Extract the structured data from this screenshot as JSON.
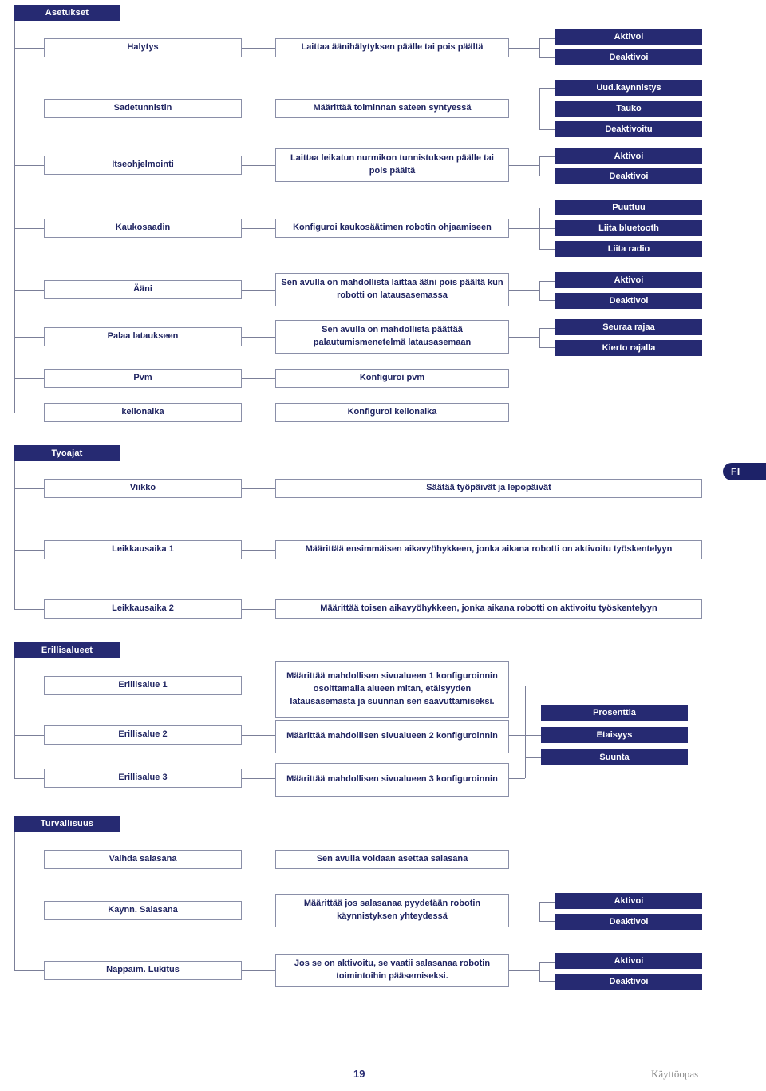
{
  "page": {
    "number": "19",
    "footer_label": "Käyttöopas",
    "language_tab": "FI",
    "accent_navy": "#262a72",
    "box_border": "#8a8fa8",
    "connector": "#7b7f98"
  },
  "sections": [
    {
      "id": "asetukset",
      "title": "Asetukset",
      "rows": [
        {
          "name": "Halytys",
          "description": "Laittaa äänihälytyksen päälle tai pois päältä",
          "options": [
            "Aktivoi",
            "Deaktivoi"
          ]
        },
        {
          "name": "Sadetunnistin",
          "description": "Määrittää toiminnan sateen syntyessä",
          "options": [
            "Uud.kaynnistys",
            "Tauko",
            "Deaktivoitu"
          ]
        },
        {
          "name": "Itseohjelmointi",
          "description": "Laittaa leikatun nurmikon tunnistuksen päälle tai pois päältä",
          "options": [
            "Aktivoi",
            "Deaktivoi"
          ]
        },
        {
          "name": "Kaukosaadin",
          "description": "Konfiguroi kaukosäätimen robotin ohjaamiseen",
          "options": [
            "Puuttuu",
            "Liita bluetooth",
            "Liita radio"
          ]
        },
        {
          "name": "Ääni",
          "description": "Sen avulla on mahdollista laittaa ääni pois päältä kun robotti on latausasemassa",
          "options": [
            "Aktivoi",
            "Deaktivoi"
          ]
        },
        {
          "name": "Palaa lataukseen",
          "description": "Sen avulla on mahdollista päättää palautumismenetelmä latausasemaan",
          "options": [
            "Seuraa rajaa",
            "Kierto rajalla"
          ]
        },
        {
          "name": "Pvm",
          "description": "Konfiguroi pvm",
          "options": []
        },
        {
          "name": "kellonaika",
          "description": "Konfiguroi kellonaika",
          "options": []
        }
      ]
    },
    {
      "id": "tyoajat",
      "title": "Tyoajat",
      "rows": [
        {
          "name": "Viikko",
          "description": "Säätää työpäivät ja lepopäivät",
          "options": []
        },
        {
          "name": "Leikkausaika  1",
          "description": "Määrittää ensimmäisen aikavyöhykkeen, jonka aikana robotti on aktivoitu työskentelyyn",
          "options": []
        },
        {
          "name": "Leikkausaika 2",
          "description": "Määrittää toisen aikavyöhykkeen, jonka aikana robotti on aktivoitu työskentelyyn",
          "options": []
        }
      ]
    },
    {
      "id": "erillisalueet",
      "title": "Erillisalueet",
      "shared_options": [
        "Prosenttia",
        "Etaisyys",
        "Suunta"
      ],
      "rows": [
        {
          "name": "Erillisalue 1",
          "description": "Määrittää mahdollisen sivualueen 1 konfiguroinnin osoittamalla alueen mitan, etäisyyden latausasemasta ja suunnan sen saavuttamiseksi."
        },
        {
          "name": "Erillisalue 2",
          "description": "Määrittää mahdollisen sivualueen 2 konfiguroinnin"
        },
        {
          "name": "Erillisalue 3",
          "description": "Määrittää mahdollisen sivualueen 3 konfiguroinnin"
        }
      ]
    },
    {
      "id": "turvallisuus",
      "title": "Turvallisuus",
      "rows": [
        {
          "name": "Vaihda salasana",
          "description": "Sen avulla voidaan asettaa salasana",
          "options": []
        },
        {
          "name": "Kaynn. Salasana",
          "description": "Määrittää jos salasanaa pyydetään robotin käynnistyksen yhteydessä",
          "options": [
            "Aktivoi",
            "Deaktivoi"
          ]
        },
        {
          "name": "Nappaim. Lukitus",
          "description": "Jos se on aktivoitu, se vaatii salasanaa robotin toimintoihin pääsemiseksi.",
          "options": [
            "Aktivoi",
            "Deaktivoi"
          ]
        }
      ]
    }
  ]
}
